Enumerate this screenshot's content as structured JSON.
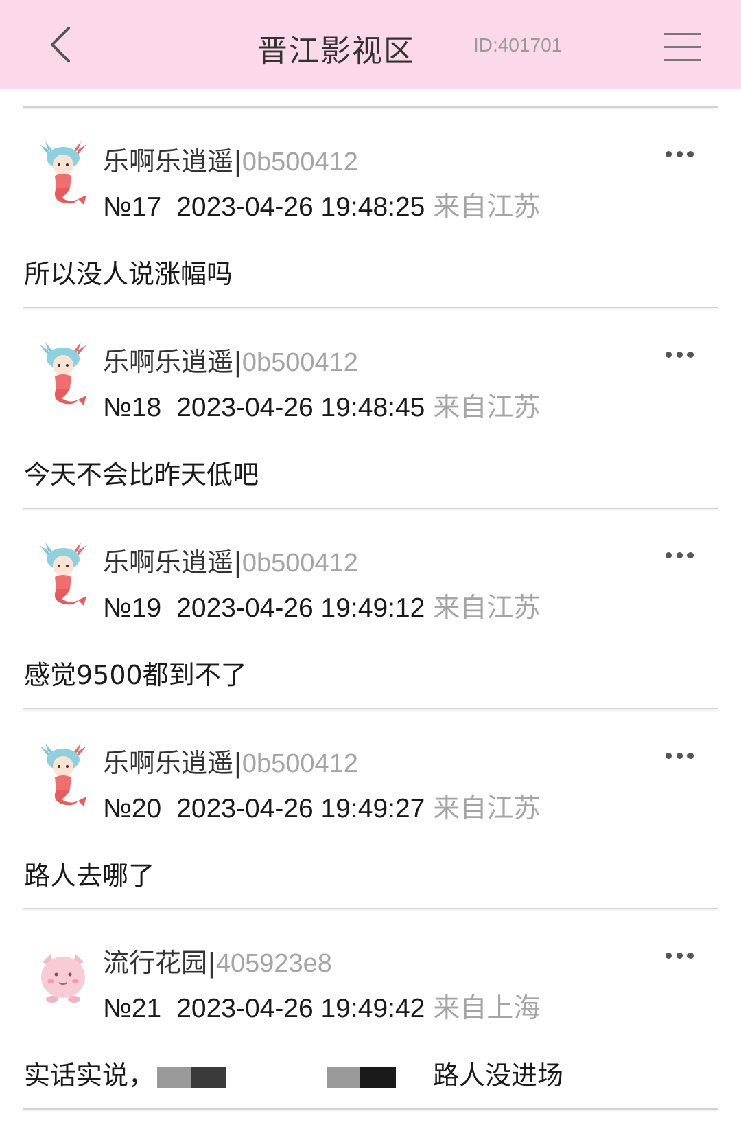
{
  "header": {
    "title": "晋江影视区",
    "board_id": "ID:401701",
    "background": "#fbd9ea",
    "back_icon": "chevron-left-icon",
    "menu_icon": "hamburger-menu-icon"
  },
  "posts": [
    {
      "username": "乐啊乐逍遥",
      "separator": "|",
      "user_id": "0b500412",
      "floor": "№17",
      "time": "2023-04-26 19:48:25",
      "location": "来自江苏",
      "content": "所以没人说涨幅吗",
      "avatar": "mermaid-avatar"
    },
    {
      "username": "乐啊乐逍遥",
      "separator": "|",
      "user_id": "0b500412",
      "floor": "№18",
      "time": "2023-04-26 19:48:45",
      "location": "来自江苏",
      "content": "今天不会比昨天低吧",
      "avatar": "mermaid-avatar"
    },
    {
      "username": "乐啊乐逍遥",
      "separator": "|",
      "user_id": "0b500412",
      "floor": "№19",
      "time": "2023-04-26 19:49:12",
      "location": "来自江苏",
      "content": "感觉9500都到不了",
      "avatar": "mermaid-avatar"
    },
    {
      "username": "乐啊乐逍遥",
      "separator": "|",
      "user_id": "0b500412",
      "floor": "№20",
      "time": "2023-04-26 19:49:27",
      "location": "来自江苏",
      "content": "路人去哪了",
      "avatar": "mermaid-avatar"
    },
    {
      "username": "流行花园",
      "separator": "|",
      "user_id": "405923e8",
      "floor": "№21",
      "time": "2023-04-26 19:49:42",
      "location": "来自上海",
      "content_start": "实话实说，",
      "content_end": "路人没进场",
      "avatar": "pink-creature-avatar"
    }
  ]
}
